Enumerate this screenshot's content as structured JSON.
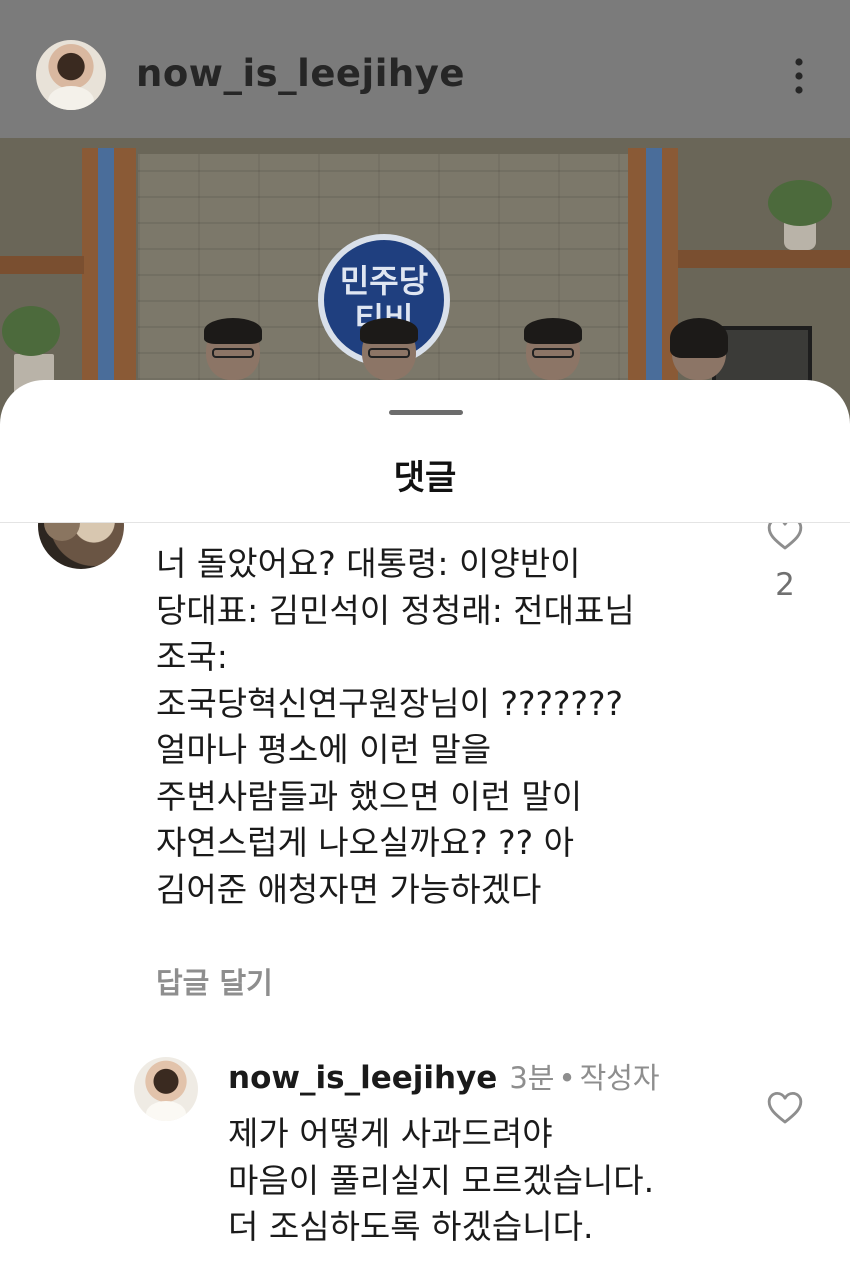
{
  "post": {
    "username": "now_is_leejihye",
    "logo_text": "민주당\n티비"
  },
  "sheet": {
    "title": "댓글"
  },
  "comments": [
    {
      "text": "너 돌았어요? 대통령: 이양반이\n당대표: 김민석이 정청래: 전대표님\n조국:\n조국당혁신연구원장님이 ???????\n얼마나 평소에 이런 말을\n주변사람들과 했으면 이런 말이\n자연스럽게 나오실까요? ?? 아\n김어준 애청자면 가능하겠다",
      "reply_label": "답글 달기",
      "likes": "2"
    }
  ],
  "reply": {
    "username": "now_is_leejihye",
    "time": "3분",
    "separator": "•",
    "author_label": "작성자",
    "text": "제가 어떻게 사과드려야\n마음이 풀리실지 모르겠습니다.\n더 조심하도록 하겠습니다."
  },
  "icons": {
    "more": "more-vertical-icon",
    "like": "heart-outline-icon"
  },
  "colors": {
    "overlay": "#7b7b7b",
    "secondary_text": "#8e8e8e",
    "primary_text": "#1a1a1a"
  }
}
